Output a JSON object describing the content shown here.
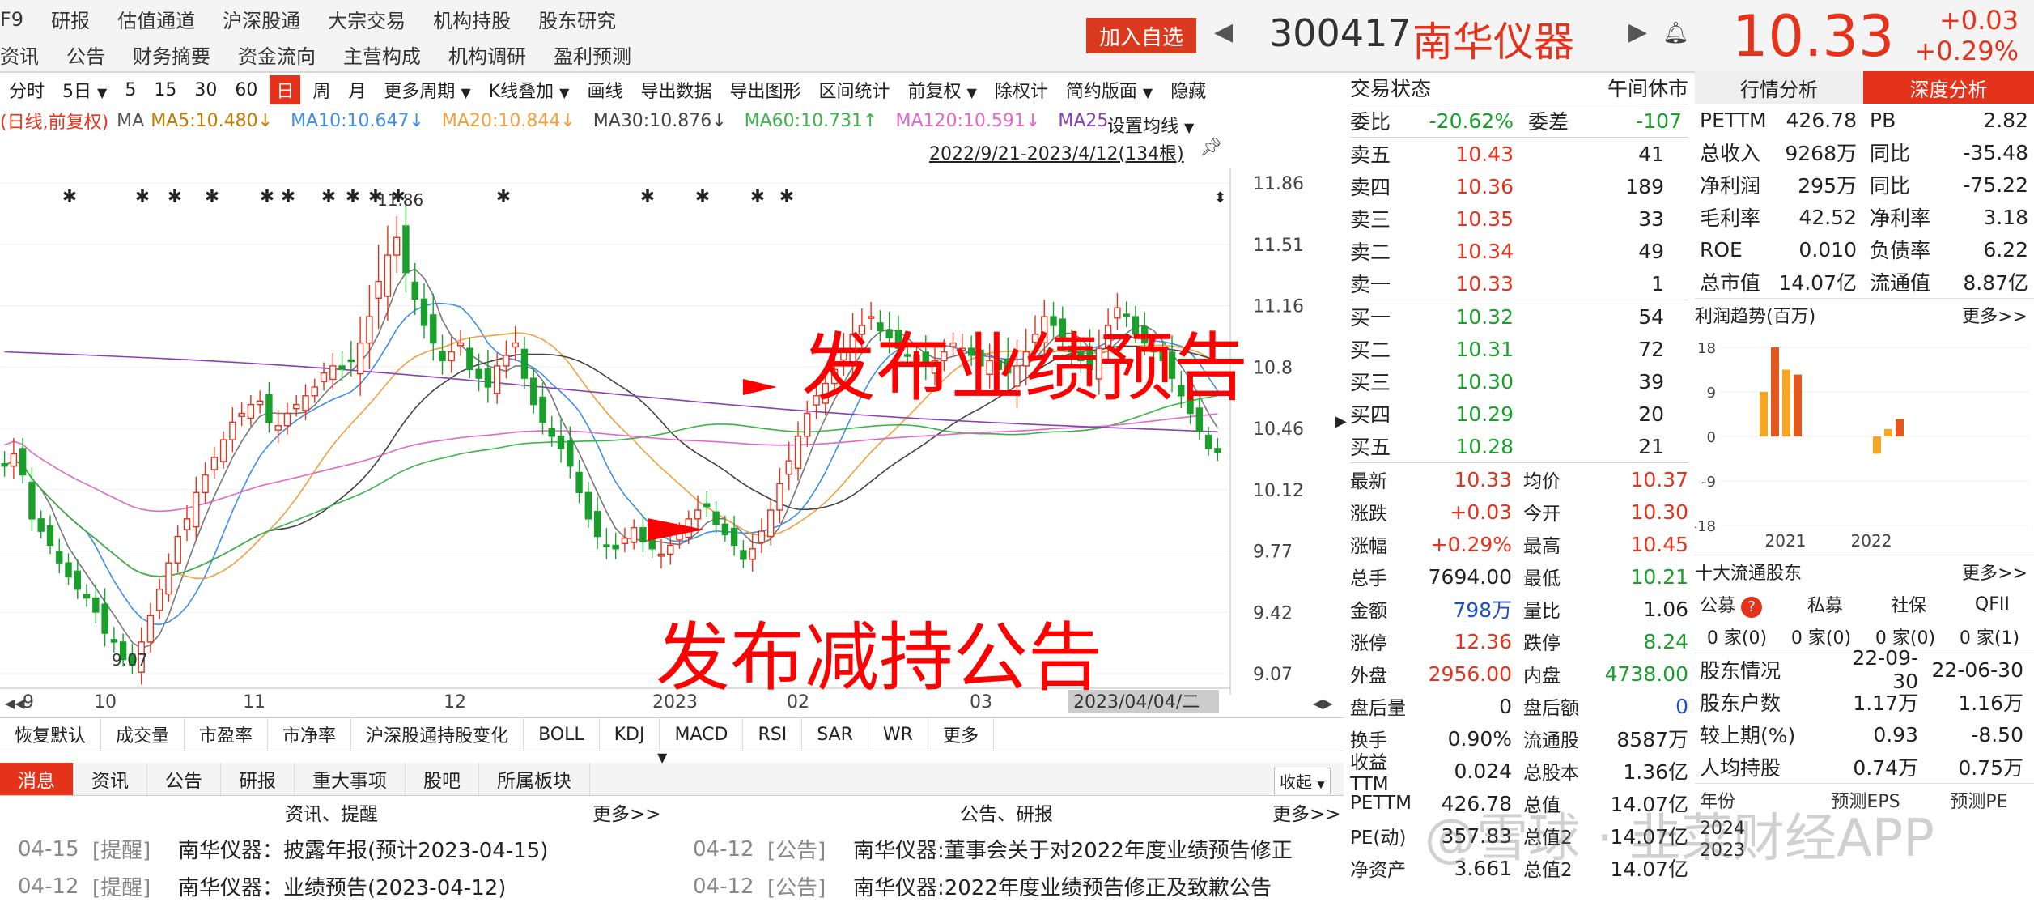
{
  "topnav": {
    "row1": [
      "F9",
      "研报",
      "估值通道",
      "沪深股通",
      "大宗交易",
      "机构持股",
      "股东研究"
    ],
    "row2": [
      "资讯",
      "公告",
      "财务摘要",
      "资金流向",
      "主营构成",
      "机构调研",
      "盈利预测"
    ]
  },
  "stock": {
    "add_label": "加入自选",
    "code": "300417",
    "name": "南华仪器",
    "price": "10.33",
    "change": "+0.03",
    "change_pct": "+0.29%"
  },
  "toolbar": [
    "分时",
    "5日",
    "5",
    "15",
    "30",
    "60",
    "日",
    "周",
    "月",
    "更多周期",
    "K线叠加",
    "画线",
    "导出数据",
    "导出图形",
    "区间统计",
    "前复权",
    "除权计",
    "简约版面",
    "隐藏"
  ],
  "ma_line": {
    "mode": "(日线,前复权)",
    "ma": "MA",
    "ma5": "MA5:10.480↓",
    "ma10": "MA10:10.647↓",
    "ma20": "MA20:10.844↓",
    "ma30": "MA30:10.876↓",
    "ma60": "MA60:10.731↑",
    "ma120": "MA120:10.591↓",
    "ma250": "MA25",
    "setting": "设置均线"
  },
  "chart_data": {
    "type": "candlestick",
    "range_label": "2022/9/21-2023/4/12(134根)",
    "y_ticks": [
      "11.86",
      "11.51",
      "11.16",
      "10.8",
      "10.46",
      "10.12",
      "9.77",
      "9.42",
      "9.07"
    ],
    "ylim": [
      9.07,
      11.86
    ],
    "x_ticks": [
      "9",
      "10",
      "11",
      "12",
      "2023",
      "02",
      "03"
    ],
    "high_label": "11.86",
    "low_label": "9.07",
    "cursor_date": "2023/04/04/二",
    "colors": {
      "up": "#e4321b",
      "down": "#18a02b",
      "ma5": "#777777",
      "ma10": "#3e8ee8",
      "ma20": "#f0a03c",
      "ma30": "#444444",
      "ma60": "#3cb34a",
      "ma120": "#e466c8",
      "ma250": "#8a3fb4"
    },
    "closes": [
      10.25,
      10.32,
      10.2,
      9.95,
      9.88,
      9.8,
      9.7,
      9.62,
      9.55,
      9.5,
      9.42,
      9.3,
      9.25,
      9.15,
      9.12,
      9.25,
      9.4,
      9.55,
      9.7,
      9.85,
      9.95,
      10.1,
      10.2,
      10.3,
      10.4,
      10.5,
      10.55,
      10.6,
      10.62,
      10.5,
      10.48,
      10.55,
      10.6,
      10.65,
      10.7,
      10.78,
      10.82,
      10.8,
      10.85,
      10.95,
      11.1,
      11.3,
      11.45,
      11.55,
      11.35,
      11.2,
      11.05,
      10.95,
      10.85,
      10.9,
      10.95,
      10.8,
      10.75,
      10.7,
      10.82,
      10.88,
      10.95,
      10.75,
      10.6,
      10.5,
      10.42,
      10.35,
      10.25,
      10.1,
      9.95,
      9.85,
      9.8,
      9.78,
      9.84,
      9.9,
      9.82,
      9.78,
      9.75,
      9.8,
      9.87,
      9.95,
      10.0,
      10.02,
      9.92,
      9.86,
      9.8,
      9.72,
      9.78,
      9.88,
      10.0,
      10.15,
      10.28,
      10.42,
      10.55,
      10.65,
      10.72,
      10.8,
      10.9,
      11.0,
      11.05,
      11.1,
      11.02,
      10.98,
      10.92,
      10.88,
      10.85,
      10.82,
      10.85,
      10.9,
      10.95,
      10.92,
      10.88,
      10.82,
      10.85,
      10.8,
      10.78,
      10.82,
      10.9,
      11.0,
      11.1,
      11.05,
      10.98,
      10.9,
      10.85,
      10.8,
      10.92,
      11.05,
      11.15,
      11.1,
      11.0,
      10.95,
      10.9,
      10.85,
      10.75,
      10.65,
      10.55,
      10.45,
      10.35,
      10.33
    ],
    "volatility": [
      0.12,
      0.15,
      0.1,
      0.14,
      0.08,
      0.1,
      0.12,
      0.09,
      0.11,
      0.1,
      0.13,
      0.15,
      0.12,
      0.08,
      0.1,
      0.14,
      0.12,
      0.1,
      0.09,
      0.11,
      0.13,
      0.15,
      0.12,
      0.1,
      0.08,
      0.14,
      0.11,
      0.09,
      0.1,
      0.12,
      0.15,
      0.1,
      0.09,
      0.11,
      0.08,
      0.1,
      0.12,
      0.14,
      0.18,
      0.25,
      0.3,
      0.35,
      0.28,
      0.2,
      0.22,
      0.18,
      0.15,
      0.2,
      0.16,
      0.14,
      0.12,
      0.1,
      0.15,
      0.18,
      0.12,
      0.14,
      0.16,
      0.12,
      0.1,
      0.14,
      0.12,
      0.16,
      0.14,
      0.12,
      0.1,
      0.14,
      0.16,
      0.12,
      0.1,
      0.08,
      0.12,
      0.1,
      0.14,
      0.12,
      0.1,
      0.08,
      0.14,
      0.12,
      0.1,
      0.08,
      0.12,
      0.1,
      0.14,
      0.12,
      0.1,
      0.15,
      0.18,
      0.14,
      0.12,
      0.16,
      0.14,
      0.12,
      0.18,
      0.2,
      0.16,
      0.14,
      0.12,
      0.18,
      0.14,
      0.12,
      0.1,
      0.16,
      0.14,
      0.12,
      0.1,
      0.14,
      0.12,
      0.1,
      0.16,
      0.14,
      0.2,
      0.25,
      0.22,
      0.18,
      0.16,
      0.14,
      0.12,
      0.16,
      0.14,
      0.2,
      0.18,
      0.16,
      0.14,
      0.12,
      0.1,
      0.14,
      0.12,
      0.1,
      0.16,
      0.14,
      0.12,
      0.1,
      0.08,
      0.1
    ]
  },
  "annotations": {
    "a1": "发布业绩预告",
    "a2": "发布减持公告"
  },
  "indicator_tabs": [
    "恢复默认",
    "成交量",
    "市盈率",
    "市净率",
    "沪深股通持股变化",
    "BOLL",
    "KDJ",
    "MACD",
    "RSI",
    "SAR",
    "WR",
    "更多"
  ],
  "news_tabs": [
    "消息",
    "资讯",
    "公告",
    "研报",
    "重大事项",
    "股吧",
    "所属板块"
  ],
  "news_collapse": "收起",
  "news_headers": {
    "left": "资讯、提醒",
    "right": "公告、研报",
    "more": "更多>>"
  },
  "news": [
    {
      "date": "04-15",
      "tag": "[提醒]",
      "title": "南华仪器：披露年报(预计2023-04-15)"
    },
    {
      "date": "04-12",
      "tag": "[提醒]",
      "title": "南华仪器：业绩预告(2023-04-12)"
    }
  ],
  "notices": [
    {
      "date": "04-12",
      "tag": "[公告]",
      "title": "南华仪器:董事会关于对2022年度业绩预告修正"
    },
    {
      "date": "04-12",
      "tag": "[公告]",
      "title": "南华仪器:2022年度业绩预告修正及致歉公告"
    }
  ],
  "order_book": {
    "status_label": "交易状态",
    "status": "午间休市",
    "weibi_label": "委比",
    "weibi": "-20.62%",
    "weicha_label": "委差",
    "weicha": "-107",
    "sells": [
      {
        "l": "卖五",
        "p": "10.43",
        "v": "41"
      },
      {
        "l": "卖四",
        "p": "10.36",
        "v": "189"
      },
      {
        "l": "卖三",
        "p": "10.35",
        "v": "33"
      },
      {
        "l": "卖二",
        "p": "10.34",
        "v": "49"
      },
      {
        "l": "卖一",
        "p": "10.33",
        "v": "1"
      }
    ],
    "buys": [
      {
        "l": "买一",
        "p": "10.32",
        "v": "54"
      },
      {
        "l": "买二",
        "p": "10.31",
        "v": "72"
      },
      {
        "l": "买三",
        "p": "10.30",
        "v": "39"
      },
      {
        "l": "买四",
        "p": "10.29",
        "v": "20"
      },
      {
        "l": "买五",
        "p": "10.28",
        "v": "21"
      }
    ],
    "stats": [
      [
        "最新",
        "10.33",
        "均价",
        "10.37"
      ],
      [
        "涨跌",
        "+0.03",
        "今开",
        "10.30"
      ],
      [
        "涨幅",
        "+0.29%",
        "最高",
        "10.45"
      ],
      [
        "总手",
        "7694.00",
        "最低",
        "10.21"
      ],
      [
        "金额",
        "798万",
        "量比",
        "1.06"
      ],
      [
        "涨停",
        "12.36",
        "跌停",
        "8.24"
      ],
      [
        "外盘",
        "2956.00",
        "内盘",
        "4738.00"
      ],
      [
        "盘后量",
        "0",
        "盘后额",
        "0"
      ],
      [
        "换手",
        "0.90%",
        "流通股",
        "8587万"
      ],
      [
        "收益TTM",
        "0.024",
        "总股本",
        "1.36亿"
      ],
      [
        "PETTM",
        "426.78",
        "总值",
        "14.07亿"
      ],
      [
        "PE(动)",
        "357.83",
        "总值2",
        "14.07亿"
      ],
      [
        "净资产",
        "3.661",
        "总值2",
        "14.07亿"
      ]
    ]
  },
  "analysis": {
    "tabs": [
      "行情分析",
      "深度分析"
    ],
    "metrics": [
      [
        "PETTM",
        "426.78",
        "PB",
        "2.82"
      ],
      [
        "总收入",
        "9268万",
        "同比",
        "-35.48"
      ],
      [
        "净利润",
        "295万",
        "同比",
        "-75.22"
      ],
      [
        "毛利率",
        "42.52",
        "净利率",
        "3.18"
      ],
      [
        "ROE",
        "0.010",
        "负债率",
        "6.22"
      ],
      [
        "总市值",
        "14.07亿",
        "流通值",
        "8.87亿"
      ]
    ],
    "profit_title": "利润趋势(百万)",
    "more": "更多>>",
    "profit_chart": {
      "y_ticks": [
        "18",
        "9",
        "0",
        "-9",
        "-18"
      ],
      "x_ticks": [
        "2021",
        "2022"
      ],
      "bars": [
        {
          "q": "2021Q1",
          "v": 9
        },
        {
          "q": "2021Q2",
          "v": 18
        },
        {
          "q": "2021Q3",
          "v": 13.5
        },
        {
          "q": "2021Q4",
          "v": 12.5
        },
        {
          "q": "2022Q1",
          "v": -3.5
        },
        {
          "q": "2022Q2",
          "v": 1.5
        },
        {
          "q": "2022Q3",
          "v": 3.5
        }
      ]
    },
    "holders_title": "十大流通股东",
    "holder_types": [
      "公募",
      "私募",
      "社保",
      "QFII"
    ],
    "holder_counts": [
      "0 家(0)",
      "0 家(0)",
      "0 家(0)",
      "0 家(1)"
    ],
    "holder_badge": "?",
    "holder_stats": [
      [
        "股东情况",
        "22-09-30",
        "22-06-30"
      ],
      [
        "股东户数",
        "1.17万",
        "1.16万"
      ],
      [
        "较上期(%)",
        "0.93",
        "-8.50"
      ],
      [
        "人均持股",
        "0.74万",
        "0.75万"
      ]
    ],
    "forecast": {
      "h1": "年份",
      "h2": "预测EPS",
      "h3": "预测PE",
      "rows": [
        "2024",
        "2023"
      ]
    },
    "watermark": "@雪球 · 韭菜财经APP"
  }
}
